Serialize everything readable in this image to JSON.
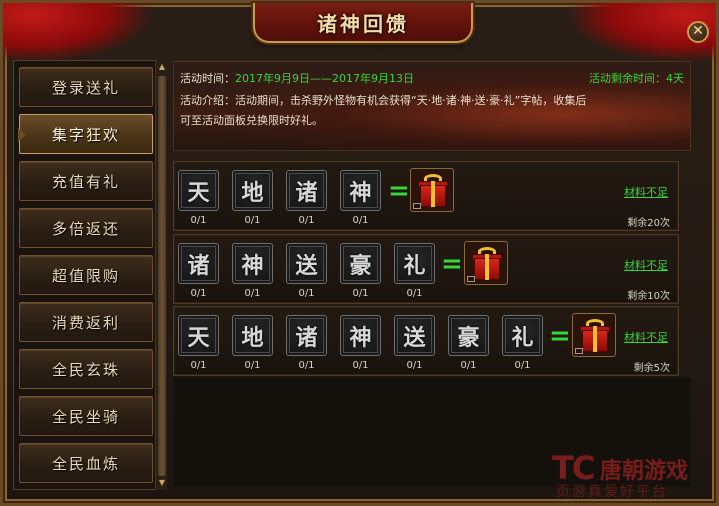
{
  "window": {
    "title": "诸神回馈",
    "close_label": "✕"
  },
  "sidebar": {
    "items": [
      {
        "label": "登录送礼",
        "active": false
      },
      {
        "label": "集字狂欢",
        "active": true
      },
      {
        "label": "充值有礼",
        "active": false
      },
      {
        "label": "多倍返还",
        "active": false
      },
      {
        "label": "超值限购",
        "active": false
      },
      {
        "label": "消费返利",
        "active": false
      },
      {
        "label": "全民玄珠",
        "active": false
      },
      {
        "label": "全民坐骑",
        "active": false
      },
      {
        "label": "全民血炼",
        "active": false
      }
    ]
  },
  "banner": {
    "time_label": "活动时间：",
    "time_value": "2017年9月9日——2017年9月13日",
    "remaining": "活动剩余时间：4天",
    "intro_line1": "活动介绍：活动期间，击杀野外怪物有机会获得“天·地·诸·神·送·豪·礼”字帖，收集后",
    "intro_line2": "可至活动面板兑换限时好礼。"
  },
  "recipes": [
    {
      "chars": [
        "天",
        "地",
        "诸",
        "神"
      ],
      "counts": [
        "0/1",
        "0/1",
        "0/1",
        "0/1"
      ],
      "equals": "=",
      "status": "材料不足",
      "remaining": "剩余20次"
    },
    {
      "chars": [
        "诸",
        "神",
        "送",
        "豪",
        "礼"
      ],
      "counts": [
        "0/1",
        "0/1",
        "0/1",
        "0/1",
        "0/1"
      ],
      "equals": "=",
      "status": "材料不足",
      "remaining": "剩余10次"
    },
    {
      "chars": [
        "天",
        "地",
        "诸",
        "神",
        "送",
        "豪",
        "礼"
      ],
      "counts": [
        "0/1",
        "0/1",
        "0/1",
        "0/1",
        "0/1",
        "0/1",
        "0/1"
      ],
      "equals": "=",
      "status": "材料不足",
      "remaining": "剩余5次"
    }
  ],
  "watermark": {
    "logo": "TC",
    "name": "唐朝游戏",
    "sub": "页游真爱好平台"
  },
  "colors": {
    "accent_green": "#39d43c",
    "title_gold": "#f3dca6",
    "ribbon_red": "#c31a1a"
  }
}
